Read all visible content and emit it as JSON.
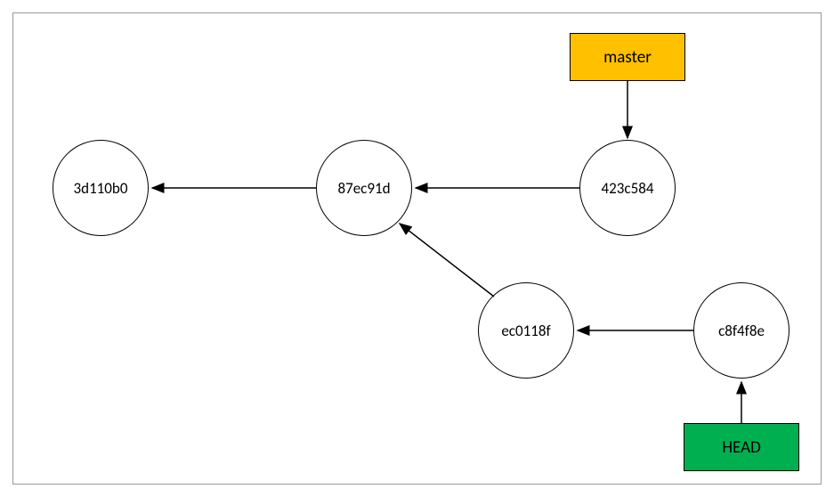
{
  "diagram": {
    "labels": {
      "master": "master",
      "head": "HEAD"
    },
    "commits": {
      "c1": "3d110b0",
      "c2": "87ec91d",
      "c3": "423c584",
      "c4": "ec0118f",
      "c5": "c8f4f8e"
    }
  },
  "chart_data": {
    "type": "diagram",
    "title": "",
    "nodes": [
      {
        "id": "3d110b0",
        "kind": "commit"
      },
      {
        "id": "87ec91d",
        "kind": "commit"
      },
      {
        "id": "423c584",
        "kind": "commit"
      },
      {
        "id": "ec0118f",
        "kind": "commit"
      },
      {
        "id": "c8f4f8e",
        "kind": "commit"
      },
      {
        "id": "master",
        "kind": "ref",
        "color": "#ffc000"
      },
      {
        "id": "HEAD",
        "kind": "ref",
        "color": "#00b050"
      }
    ],
    "edges": [
      {
        "from": "87ec91d",
        "to": "3d110b0"
      },
      {
        "from": "423c584",
        "to": "87ec91d"
      },
      {
        "from": "ec0118f",
        "to": "87ec91d"
      },
      {
        "from": "c8f4f8e",
        "to": "ec0118f"
      },
      {
        "from": "master",
        "to": "423c584"
      },
      {
        "from": "HEAD",
        "to": "c8f4f8e"
      }
    ]
  }
}
